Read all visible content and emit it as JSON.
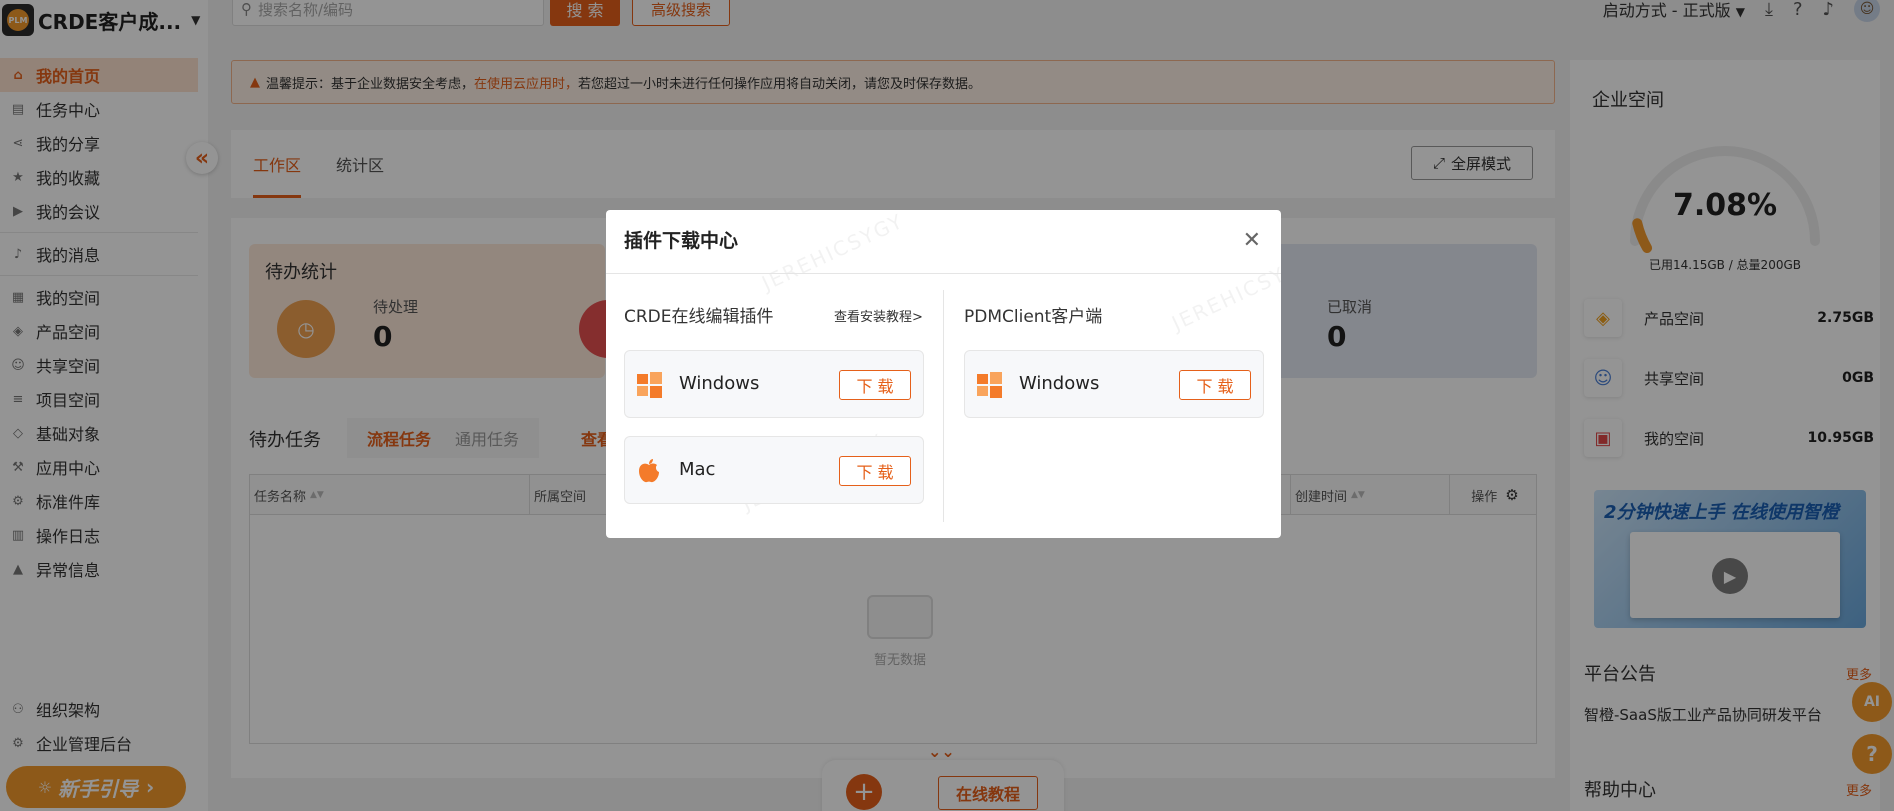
{
  "brand": {
    "logo_text": "PLM",
    "name": "CRDE客户成..."
  },
  "sidebar": {
    "items": [
      {
        "label": "我的首页",
        "icon": "home-icon",
        "glyph": "⌂"
      },
      {
        "label": "任务中心",
        "icon": "clipboard-icon",
        "glyph": "▤"
      },
      {
        "label": "我的分享",
        "icon": "share-icon",
        "glyph": "⋖"
      },
      {
        "label": "我的收藏",
        "icon": "star-icon",
        "glyph": "★"
      },
      {
        "label": "我的会议",
        "icon": "video-icon",
        "glyph": "▶"
      },
      {
        "label": "我的消息",
        "icon": "bell-icon",
        "glyph": "♪"
      },
      {
        "label": "我的空间",
        "icon": "storage-icon",
        "glyph": "▦"
      },
      {
        "label": "产品空间",
        "icon": "cube-icon",
        "glyph": "◈"
      },
      {
        "label": "共享空间",
        "icon": "users-icon",
        "glyph": "☺"
      },
      {
        "label": "项目空间",
        "icon": "database-icon",
        "glyph": "≡"
      },
      {
        "label": "基础对象",
        "icon": "layers-icon",
        "glyph": "◇"
      },
      {
        "label": "应用中心",
        "icon": "apps-icon",
        "glyph": "⚒"
      },
      {
        "label": "标准件库",
        "icon": "gear-icon",
        "glyph": "⚙"
      },
      {
        "label": "操作日志",
        "icon": "log-icon",
        "glyph": "▥"
      },
      {
        "label": "异常信息",
        "icon": "warning-icon",
        "glyph": "▲"
      }
    ],
    "bottom_items": [
      {
        "label": "组织架构",
        "icon": "org-icon",
        "glyph": "⚇"
      },
      {
        "label": "企业管理后台",
        "icon": "settings-icon",
        "glyph": "⚙"
      }
    ],
    "guide_label": "新手引导",
    "guide_arrow": "›"
  },
  "topbar": {
    "search_placeholder": "搜索名称/编码",
    "search_button": "搜 索",
    "advanced_search": "高级搜索",
    "launch_mode": "启动方式 - 正式版"
  },
  "notice": {
    "prefix": "温馨提示：基于企业数据安全考虑，",
    "highlight": "在使用云应用时，",
    "suffix": "若您超过一小时未进行任何操作应用将自动关闭，请您及时保存数据。"
  },
  "tabs": {
    "items": [
      "工作区",
      "统计区"
    ],
    "fullscreen": "全屏模式"
  },
  "stats": {
    "title": "待办统计",
    "pending_label": "待处理",
    "pending_value": "0",
    "cancelled_label": "已取消",
    "cancelled_value": "0"
  },
  "todo": {
    "title": "待办任务",
    "subtabs": [
      "流程任务",
      "通用任务"
    ],
    "view_link": "查看",
    "columns": [
      "任务名称",
      "所属空间",
      "创建时间",
      "操作"
    ],
    "empty_text": "暂无数据"
  },
  "bottom_bar": {
    "plus": "+",
    "tutorial": "在线教程"
  },
  "right": {
    "title": "企业空间",
    "usage_percent": 7.08,
    "usage_text": "7.08%",
    "usage_detail": "已用14.15GB / 总量200GB",
    "spaces": [
      {
        "name": "产品空间",
        "value": "2.75GB",
        "icon": "cube-icon",
        "color": "#f0a020"
      },
      {
        "name": "共享空间",
        "value": "0GB",
        "icon": "users-icon",
        "color": "#4a7fd6"
      },
      {
        "name": "我的空间",
        "value": "10.95GB",
        "icon": "archive-icon",
        "color": "#e04848"
      }
    ],
    "promo_text": "2分钟快速上手 在线使用智橙",
    "announcement_title": "平台公告",
    "announcement_more": "更多",
    "announcement_text": "智橙-SaaS版工业产品协同研发平台",
    "help_title": "帮助中心",
    "help_more": "更多"
  },
  "modal": {
    "title": "插件下载中心",
    "left_title": "CRDE在线编辑插件",
    "install_guide": "查看安装教程>",
    "right_title": "PDMClient客户端",
    "plugins_left": [
      {
        "name": "Windows",
        "button": "下 载"
      },
      {
        "name": "Mac",
        "button": "下 载"
      }
    ],
    "plugins_right": [
      {
        "name": "Windows",
        "button": "下 载"
      }
    ]
  },
  "colors": {
    "accent": "#e5601a",
    "accent_light": "#f39a2c"
  }
}
